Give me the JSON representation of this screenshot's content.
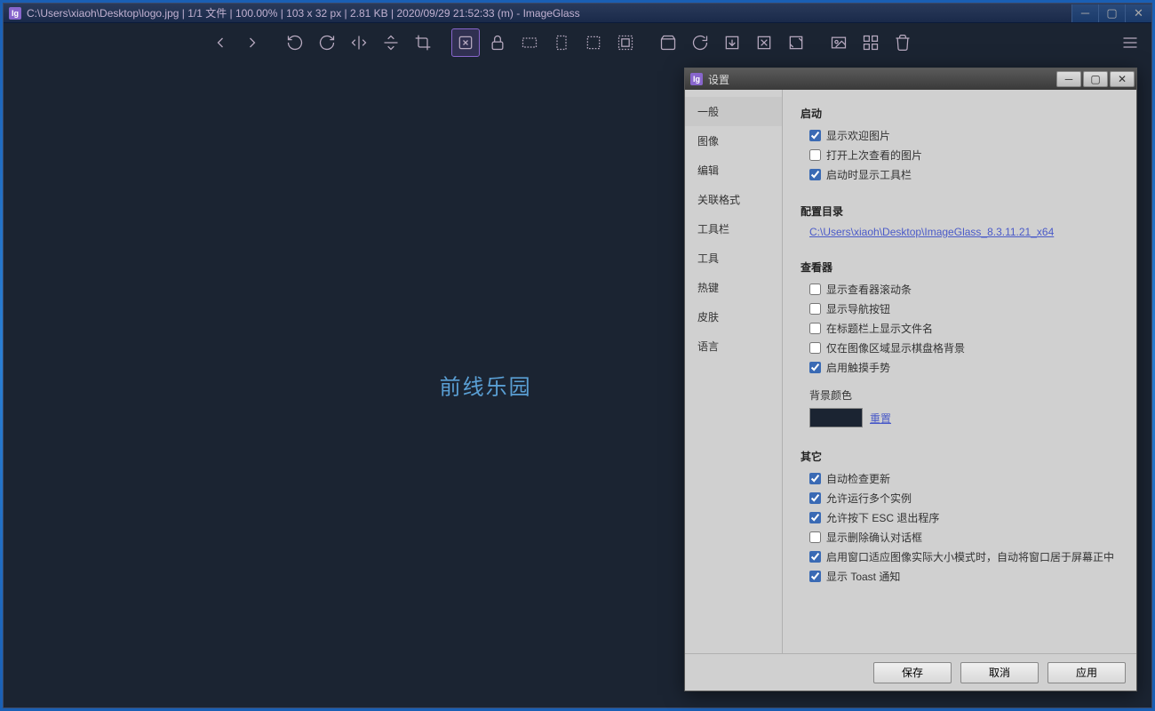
{
  "titlebar": {
    "path": "C:\\Users\\xiaoh\\Desktop\\logo.jpg",
    "file_counter": "1/1 文件",
    "zoom": "100.00%",
    "dimensions": "103 x 32 px",
    "filesize": "2.81 KB",
    "timestamp": "2020/09/29 21:52:33 (m)",
    "app_name": "ImageGlass",
    "full_text": "C:\\Users\\xiaoh\\Desktop\\logo.jpg  |  1/1 文件  |  100.00%  |  103 x 32 px  |  2.81 KB  |  2020/09/29 21:52:33 (m)   - ImageGlass"
  },
  "image_text": "前线乐园",
  "settings": {
    "title": "设置",
    "nav": {
      "general": "一般",
      "image": "图像",
      "edit": "编辑",
      "assoc": "关联格式",
      "toolbar": "工具栏",
      "tools": "工具",
      "hotkeys": "热键",
      "skin": "皮肤",
      "language": "语言"
    },
    "sections": {
      "startup": {
        "title": "启动",
        "show_welcome": "显示欢迎图片",
        "open_last": "打开上次查看的图片",
        "show_toolbar": "启动时显示工具栏"
      },
      "config_dir": {
        "title": "配置目录",
        "path": "C:\\Users\\xiaoh\\Desktop\\ImageGlass_8.3.11.21_x64"
      },
      "viewer": {
        "title": "查看器",
        "show_scrollbar": "显示查看器滚动条",
        "show_nav": "显示导航按钮",
        "show_filename": "在标题栏上显示文件名",
        "checker_bg": "仅在图像区域显示棋盘格背景",
        "touch_gesture": "启用触摸手势",
        "bg_color_label": "背景颜色",
        "reset": "重置"
      },
      "other": {
        "title": "其它",
        "auto_update": "自动检查更新",
        "multi_instance": "允许运行多个实例",
        "esc_exit": "允许按下 ESC 退出程序",
        "delete_confirm": "显示删除确认对话框",
        "window_fit": "启用窗口适应图像实际大小模式时，自动将窗口居于屏幕正中",
        "toast": "显示 Toast 通知"
      }
    },
    "buttons": {
      "save": "保存",
      "cancel": "取消",
      "apply": "应用"
    },
    "checked": {
      "show_welcome": true,
      "open_last": false,
      "show_toolbar": true,
      "show_scrollbar": false,
      "show_nav": false,
      "show_filename": false,
      "checker_bg": false,
      "touch_gesture": true,
      "auto_update": true,
      "multi_instance": true,
      "esc_exit": true,
      "delete_confirm": false,
      "window_fit": true,
      "toast": true
    }
  }
}
